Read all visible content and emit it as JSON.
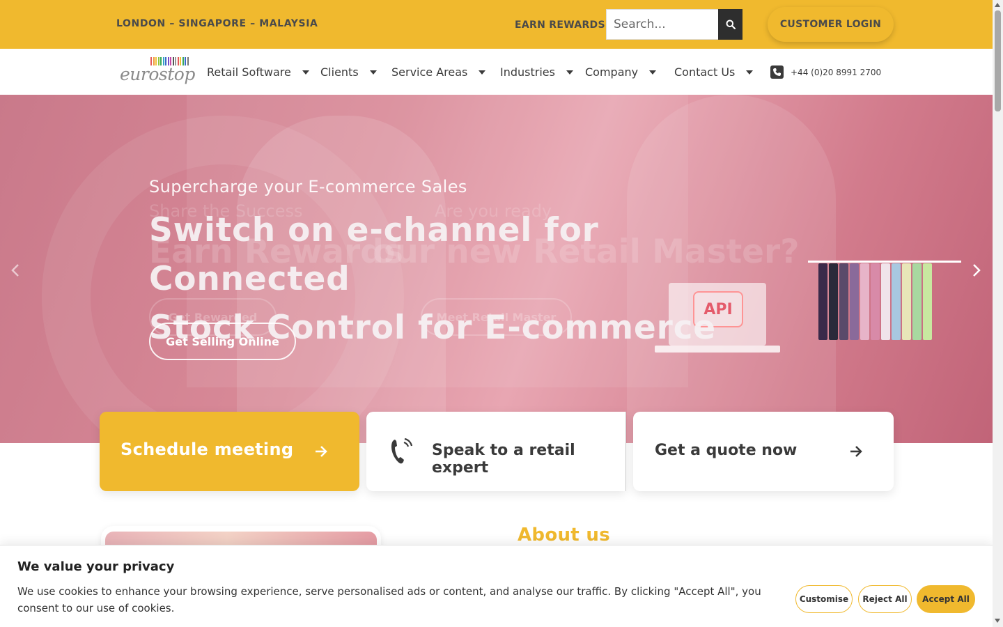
{
  "topbar": {
    "locations": "LONDON – SINGAPORE – MALAYSIA",
    "earn_rewards": "EARN REWARDS",
    "search_placeholder": "Search...",
    "customer_login": "CUSTOMER LOGIN",
    "bg_color": "#f0b92e"
  },
  "nav": {
    "logo_text": "eurostop",
    "items": [
      {
        "label": "Retail Software"
      },
      {
        "label": "Clients"
      },
      {
        "label": "Service Areas"
      },
      {
        "label": "Industries"
      },
      {
        "label": "Company"
      },
      {
        "label": "Contact Us"
      }
    ],
    "phone": "+44 (0)20 8991 2700"
  },
  "hero": {
    "subtitle": "Supercharge your E-commerce Sales",
    "title_line1": "Switch on e-channel for Connected",
    "title_line2": "Stock Control for E-commerce",
    "cta": "Get Selling Online",
    "ghost_slides": {
      "sub1": "Share the Success",
      "sub2": "Are you ready",
      "title1": "Earn Rewards",
      "title2": "our new Retail Master?",
      "btn1": "Get Rewarded",
      "btn2": "Meet Retail Master"
    },
    "api_label": "API"
  },
  "cta_cards": {
    "schedule": "Schedule meeting",
    "speak": "Speak to a retail expert",
    "quote": "Get a quote now"
  },
  "about": {
    "title": "About us"
  },
  "cookie": {
    "title": "We value your privacy",
    "text": "We use cookies to enhance your browsing experience, serve personalised ads or content, and analyse our traffic. By clicking \"Accept All\", you consent to our use of cookies.",
    "customise": "Customise",
    "reject": "Reject All",
    "accept": "Accept All"
  }
}
